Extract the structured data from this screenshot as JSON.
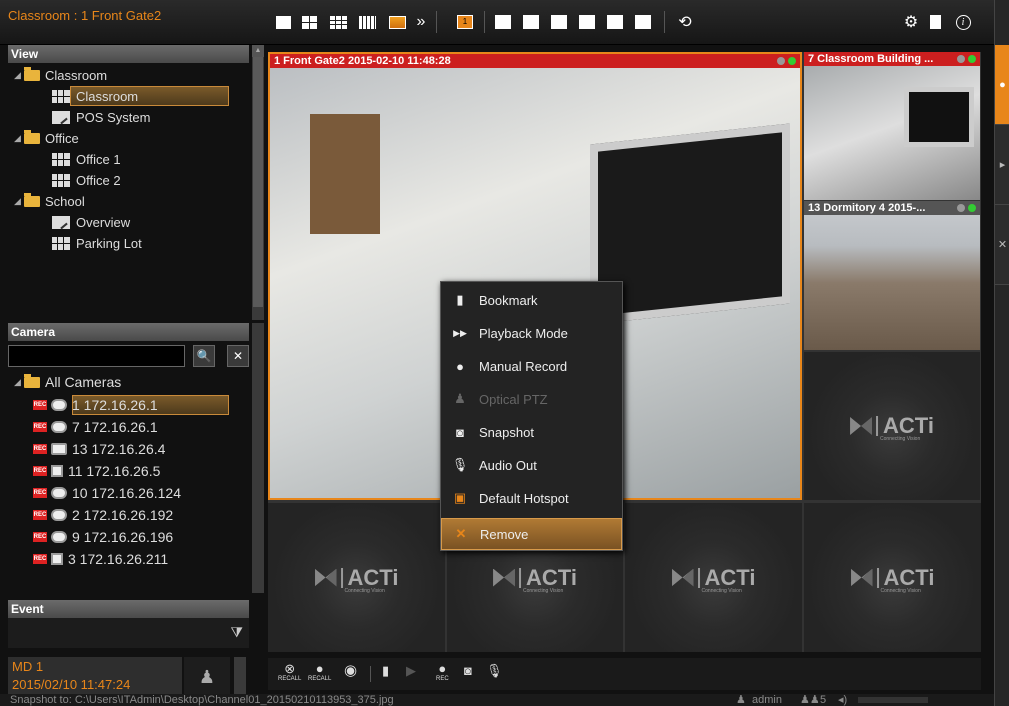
{
  "window": {
    "title": "Classroom : 1 Front Gate2"
  },
  "toolbar": {
    "more": "»",
    "hotspot_badge": "1",
    "icons": [
      "layout-1x1-icon",
      "layout-2x2-icon",
      "layout-3x3-icon",
      "layout-4x4-icon",
      "layout-custom-icon",
      "more-icon",
      "hotspot-icon",
      "edit-view-icon",
      "add-view-icon",
      "delete-view-icon",
      "rename-view-icon",
      "save-view-icon",
      "view-settings-icon",
      "sync-icon",
      "settings-icon",
      "report-icon",
      "info-icon"
    ]
  },
  "view_panel": {
    "title": "View",
    "items": [
      {
        "label": "Classroom",
        "type": "folder"
      },
      {
        "label": "Classroom",
        "type": "layout",
        "selected": true
      },
      {
        "label": "POS System",
        "type": "pos"
      },
      {
        "label": "Office",
        "type": "folder"
      },
      {
        "label": "Office 1",
        "type": "layout"
      },
      {
        "label": "Office 2",
        "type": "layout"
      },
      {
        "label": "School",
        "type": "folder"
      },
      {
        "label": "Overview",
        "type": "pos"
      },
      {
        "label": "Parking Lot",
        "type": "layout"
      }
    ]
  },
  "camera_panel": {
    "title": "Camera",
    "search_placeholder": "",
    "search_icon": "🔍",
    "clear_icon": "✕",
    "root": "All Cameras",
    "rec_label": "REC",
    "cameras": [
      {
        "label": "1 172.16.26.1",
        "selected": true
      },
      {
        "label": "7 172.16.26.1"
      },
      {
        "label": "13 172.16.26.4"
      },
      {
        "label": "11 172.16.26.5"
      },
      {
        "label": "10 172.16.26.124"
      },
      {
        "label": "2 172.16.26.192"
      },
      {
        "label": "9 172.16.26.196"
      },
      {
        "label": "3 172.16.26.211"
      }
    ]
  },
  "event_panel": {
    "title": "Event",
    "filter_icon": "⧩",
    "events": [
      {
        "title": "MD 1",
        "time": "2015/02/10 11:47:24"
      }
    ]
  },
  "video_tiles": [
    {
      "header": "1 Front Gate2  2015-02-10 11:48:28",
      "header_color": "#cc1f1f"
    },
    {
      "header": "7 Classroom Building ...",
      "header_color": "#cc1f1f"
    },
    {
      "header": "13 Dormitory 4  2015-...",
      "header_color": "#555555"
    }
  ],
  "brand": {
    "name": "ACTi",
    "tagline": "Connecting Vision"
  },
  "context_menu": {
    "items": [
      {
        "label": "Bookmark",
        "icon": "bookmark-icon",
        "glyph": "▮"
      },
      {
        "label": "Playback Mode",
        "icon": "playback-icon",
        "glyph": "▶▶"
      },
      {
        "label": "Manual Record",
        "icon": "record-icon",
        "glyph": "●"
      },
      {
        "label": "Optical PTZ",
        "icon": "ptz-icon",
        "glyph": "♟",
        "disabled": true
      },
      {
        "label": "Snapshot",
        "icon": "camera-icon",
        "glyph": "◙"
      },
      {
        "label": "Audio Out",
        "icon": "microphone-icon",
        "glyph": "🎙"
      },
      {
        "label": "Default Hotspot",
        "icon": "hotspot-icon",
        "glyph": "▣"
      },
      {
        "label": "Remove",
        "icon": "close-icon",
        "glyph": "✕",
        "highlighted": true
      }
    ]
  },
  "bottom_toolbar": {
    "recall1": "RECALL",
    "recall2": "RECALL",
    "rec": "REC"
  },
  "status_bar": {
    "message": "Snapshot to: C:\\Users\\ITAdmin\\Desktop\\Channel01_20150210113953_375.jpg",
    "user": "admin",
    "user_count": "5"
  },
  "colors": {
    "accent": "#e8861a",
    "record": "#dd2222",
    "online": "#33cc33"
  }
}
